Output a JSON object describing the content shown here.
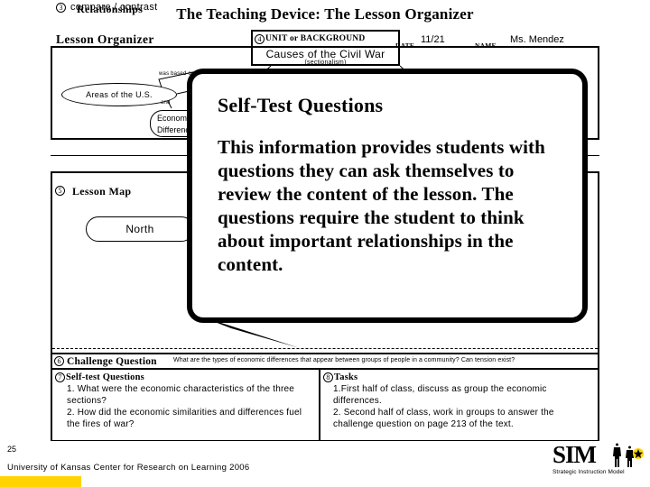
{
  "slide": {
    "title": "The Teaching Device: The Lesson Organizer",
    "page_number": "25",
    "copyright": "University of Kansas Center for Research on Learning  2006"
  },
  "organizer": {
    "label": "Lesson Organizer",
    "unit_box": {
      "number": "4",
      "header": "UNIT or BACKGROUND",
      "title": "Causes of the Civil War",
      "subtitle": "(sectionalism)"
    },
    "date": {
      "label": "DATE",
      "value": "11/21"
    },
    "name": {
      "label": "NAME",
      "value": "Ms. Mendez"
    },
    "paraphrase": {
      "areas_oval": "Areas of the U.S.",
      "connector_1": "was based on",
      "connector_2": "and",
      "econ_oval_line1": "Economic",
      "econ_oval_line2": "Differences"
    },
    "relationships": {
      "number": "3",
      "title": "Relationships",
      "value": "compare / contrast"
    },
    "lesson_map": {
      "number": "5",
      "title": "Lesson Map",
      "node_north": "North"
    },
    "challenge": {
      "number": "6",
      "title": "Challenge Question",
      "text": "What are the types of economic differences that appear between groups of people in a community?  Can tension exist?"
    },
    "self_test": {
      "number": "7",
      "title": "Self-test Questions",
      "items": [
        "1. What were the economic characteristics of the three sections?",
        "2. How did the economic similarities and differences fuel the fires of war?"
      ]
    },
    "tasks": {
      "number": "8",
      "title": "Tasks",
      "items": [
        "1.First half of class, discuss as group the economic differences.",
        "2. Second half of class, work in groups to answer the challenge  question on page 213 of the text."
      ]
    }
  },
  "callout": {
    "title": "Self-Test Questions",
    "body": "This information provides students with questions they can ask themselves to review the content of the lesson.  The questions require the student to think about important relationships in the content."
  },
  "logo": {
    "word": "SIM",
    "tagline": "Strategic Instruction Model",
    "accent_color": "#ffd400"
  }
}
